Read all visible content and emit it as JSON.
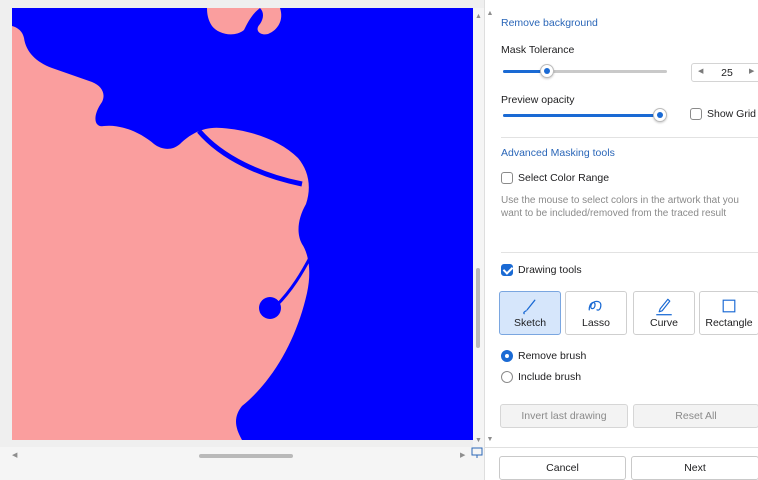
{
  "canvas": {
    "background_color": "#fa9e9e",
    "shape_color": "#0000ff"
  },
  "panel": {
    "remove_background": {
      "title": "Remove background"
    },
    "mask_tolerance": {
      "label": "Mask Tolerance",
      "value": "25",
      "slider_fraction": 0.28
    },
    "preview_opacity": {
      "label": "Preview opacity",
      "slider_fraction": 1.0
    },
    "show_grid": {
      "label": "Show Grid",
      "checked": false
    },
    "advanced": {
      "title": "Advanced Masking tools",
      "select_color_range": {
        "label": "Select Color Range",
        "checked": false
      },
      "help_text": "Use the mouse to select colors in the artwork that you want to be included/removed from the traced result"
    },
    "drawing_tools": {
      "label": "Drawing tools",
      "checked": true,
      "tools": [
        {
          "label": "Sketch",
          "icon": "brush-icon",
          "active": true
        },
        {
          "label": "Lasso",
          "icon": "lasso-icon",
          "active": false
        },
        {
          "label": "Curve",
          "icon": "curve-pen-icon",
          "active": false
        },
        {
          "label": "Rectangle",
          "icon": "rectangle-icon",
          "active": false
        }
      ]
    },
    "brush_mode": {
      "options": [
        {
          "label": "Remove brush",
          "selected": true
        },
        {
          "label": "Include brush",
          "selected": false
        }
      ]
    },
    "invert_button": "Invert last drawing",
    "reset_button": "Reset All",
    "cancel_button": "Cancel",
    "next_button": "Next"
  },
  "colors": {
    "accent": "#1a6ad4",
    "section_title": "#2a66b8"
  }
}
